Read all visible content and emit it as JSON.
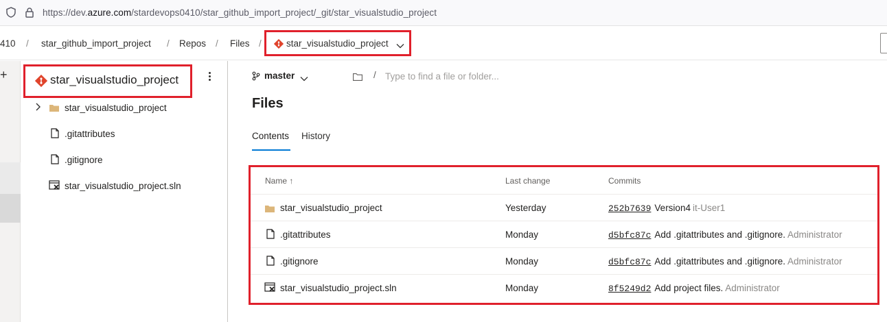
{
  "browser": {
    "url_prefix": "https://dev.",
    "url_domain": "azure.com",
    "url_rest": "/stardevops0410/star_github_import_project/_git/star_visualstudio_project"
  },
  "breadcrumb": {
    "org_fragment": "410",
    "project": "star_github_import_project",
    "repos": "Repos",
    "files": "Files",
    "repo": "star_visualstudio_project",
    "separator": "/"
  },
  "tree": {
    "repo_name": "star_visualstudio_project",
    "items": [
      {
        "label": "star_visualstudio_project",
        "kind": "folder"
      },
      {
        "label": ".gitattributes",
        "kind": "file"
      },
      {
        "label": ".gitignore",
        "kind": "file"
      },
      {
        "label": "star_visualstudio_project.sln",
        "kind": "sln"
      }
    ]
  },
  "main": {
    "branch": "master",
    "path_sep": "/",
    "path_placeholder": "Type to find a file or folder...",
    "title": "Files",
    "tabs": [
      {
        "label": "Contents",
        "active": true
      },
      {
        "label": "History",
        "active": false
      }
    ],
    "grid": {
      "headers": {
        "name": "Name",
        "sort_glyph": "↑",
        "last_change": "Last change",
        "commits": "Commits"
      },
      "rows": [
        {
          "name": "star_visualstudio_project",
          "kind": "folder",
          "last_change": "Yesterday",
          "hash": "252b7639",
          "message": "Version4",
          "author": "it-User1"
        },
        {
          "name": ".gitattributes",
          "kind": "file",
          "last_change": "Monday",
          "hash": "d5bfc87c",
          "message": "Add .gitattributes and .gitignore.",
          "author": "Administrator"
        },
        {
          "name": ".gitignore",
          "kind": "file",
          "last_change": "Monday",
          "hash": "d5bfc87c",
          "message": "Add .gitattributes and .gitignore.",
          "author": "Administrator"
        },
        {
          "name": "star_visualstudio_project.sln",
          "kind": "sln",
          "last_change": "Monday",
          "hash": "8f5249d2",
          "message": "Add project files.",
          "author": "Administrator"
        }
      ]
    }
  },
  "colors": {
    "highlight_border": "#e0202b",
    "git_icon": "#e0442c",
    "folder_icon": "#dcb67a",
    "accent": "#0078d4"
  }
}
